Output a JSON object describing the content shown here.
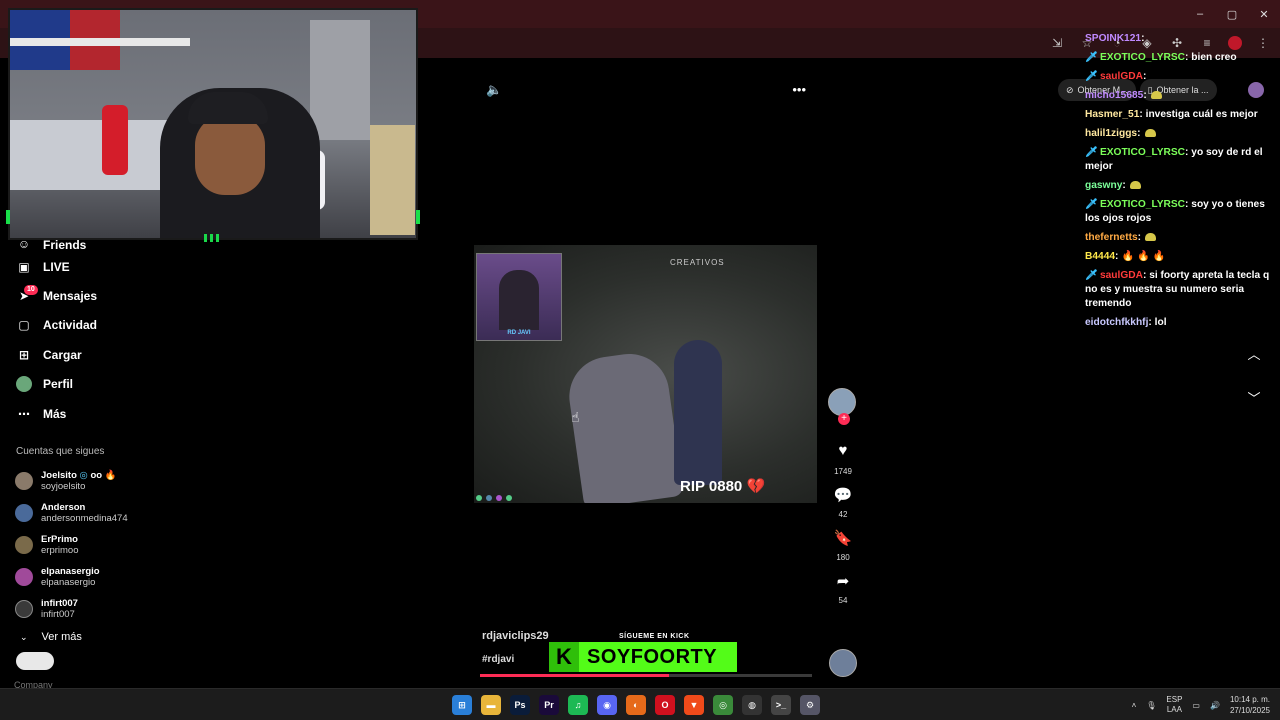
{
  "browser": {
    "window_controls": [
      "–",
      "▢",
      "✕"
    ],
    "toolbar_icons": [
      "install-icon",
      "star-icon",
      "incognito-icon",
      "extension-icon",
      "puzzle-icon",
      "playlist-icon",
      "profile-icon",
      "menu-icon"
    ],
    "accent": "#3a1418"
  },
  "webcam": {},
  "sidebar": {
    "items": [
      {
        "label": "Friends",
        "icon": "friends-icon"
      },
      {
        "label": "LIVE",
        "icon": "live-icon"
      },
      {
        "label": "Mensajes",
        "icon": "send-icon",
        "badge": "10"
      },
      {
        "label": "Actividad",
        "icon": "activity-icon"
      },
      {
        "label": "Cargar",
        "icon": "upload-icon"
      },
      {
        "label": "Perfil",
        "icon": "profile-icon"
      },
      {
        "label": "Más",
        "icon": "more-icon"
      }
    ],
    "following_title": "Cuentas que sigues",
    "following": [
      {
        "name": "Joelsito",
        "suffix": "oo",
        "handle": "soyjoelsito",
        "color": "#8a7a6a"
      },
      {
        "name": "Anderson",
        "handle": "andersonmedina474",
        "color": "#4a6a9a"
      },
      {
        "name": "ErPrimo",
        "handle": "erprimoo",
        "color": "#7a6a4a"
      },
      {
        "name": "elpanasergio",
        "handle": "elpanasergio",
        "color": "#a04a9a"
      },
      {
        "name": "infirt007",
        "handle": "infirt007",
        "color": "#3a3a3a"
      }
    ],
    "ver_mas": "Ver más",
    "cut_text": "Company"
  },
  "video": {
    "pip_label": "RD JAVI",
    "watermark": "CREATIVOS",
    "caption": "RIP 0880",
    "caption_emoji": "💔",
    "username": "rdjaviclips29",
    "hashtag": "#rdjavi",
    "progress_fraction": 0.57
  },
  "actions": {
    "likes": "1749",
    "comments": "42",
    "saves": "180",
    "shares": "54"
  },
  "kick": {
    "subtitle": "SÍGUEME EN KICK",
    "name": "SOYFOORTY",
    "color": "#53fc18"
  },
  "obtener": [
    "Obtener M...",
    "Obtener la ..."
  ],
  "chat": [
    {
      "user": "SPOINK121",
      "text": "",
      "color": "#c08aff",
      "sword": false
    },
    {
      "user": "EXOTICO_LYRSC",
      "text": "bien creo",
      "color": "#7cff5a",
      "sword": true
    },
    {
      "user": "saulGDA",
      "text": "",
      "color": "#ff3b3b",
      "sword": true
    },
    {
      "user": "micho15685",
      "text": "",
      "color": "#c08aff",
      "sword": false,
      "emote": true
    },
    {
      "user": "Hasmer_51",
      "text": "investiga cuál es mejor",
      "color": "#ffe8a0",
      "sword": false
    },
    {
      "user": "halil1ziggs",
      "text": "",
      "color": "#ffe8a0",
      "sword": false,
      "emote": true
    },
    {
      "user": "EXOTICO_LYRSC",
      "text": "yo soy de rd el mejor",
      "color": "#7cff5a",
      "sword": true
    },
    {
      "user": "gaswny",
      "text": "",
      "color": "#7cff9a",
      "sword": false,
      "emote": true
    },
    {
      "user": "EXOTICO_LYRSC",
      "text": "soy yo o tienes los ojos rojos",
      "color": "#7cff5a",
      "sword": true
    },
    {
      "user": "thefernetts",
      "text": "",
      "color": "#ffaa44",
      "sword": false,
      "emote": true
    },
    {
      "user": "B4444",
      "text": "",
      "color": "#ffe84a",
      "sword": false,
      "fire": "🔥 🔥 🔥"
    },
    {
      "user": "saulGDA",
      "text": "si foorty apreta la tecla q no es y muestra su numero seria tremendo",
      "color": "#ff3b3b",
      "sword": true
    },
    {
      "user": "eidotchfkkhfj",
      "text": "lol",
      "color": "#c9c9ff",
      "sword": false
    }
  ],
  "taskbar": {
    "apps": [
      {
        "name": "windows-start-icon",
        "glyph": "⊞",
        "bg": "#2a7fd8"
      },
      {
        "name": "file-explorer-icon",
        "glyph": "▬",
        "bg": "#e8b53a"
      },
      {
        "name": "photoshop-icon",
        "glyph": "Ps",
        "bg": "#0a1c3a"
      },
      {
        "name": "premiere-icon",
        "glyph": "Pr",
        "bg": "#1a0a3a"
      },
      {
        "name": "spotify-icon",
        "glyph": "♫",
        "bg": "#1db954"
      },
      {
        "name": "discord-icon",
        "glyph": "◉",
        "bg": "#5865f2"
      },
      {
        "name": "firefox-icon",
        "glyph": "◐",
        "bg": "#e66a1a"
      },
      {
        "name": "opera-icon",
        "glyph": "O",
        "bg": "#d0101e"
      },
      {
        "name": "brave-icon",
        "glyph": "▼",
        "bg": "#f04a1a"
      },
      {
        "name": "chrome-icon",
        "glyph": "◎",
        "bg": "#3a8a3a"
      },
      {
        "name": "obs-icon",
        "glyph": "◍",
        "bg": "#333"
      },
      {
        "name": "terminal-icon",
        "glyph": ">_",
        "bg": "#444"
      },
      {
        "name": "settings-app-icon",
        "glyph": "⚙",
        "bg": "#556"
      }
    ],
    "lang_top": "ESP",
    "lang_bottom": "LAA",
    "time": "10:14 p. m.",
    "date": "27/10/2025"
  }
}
